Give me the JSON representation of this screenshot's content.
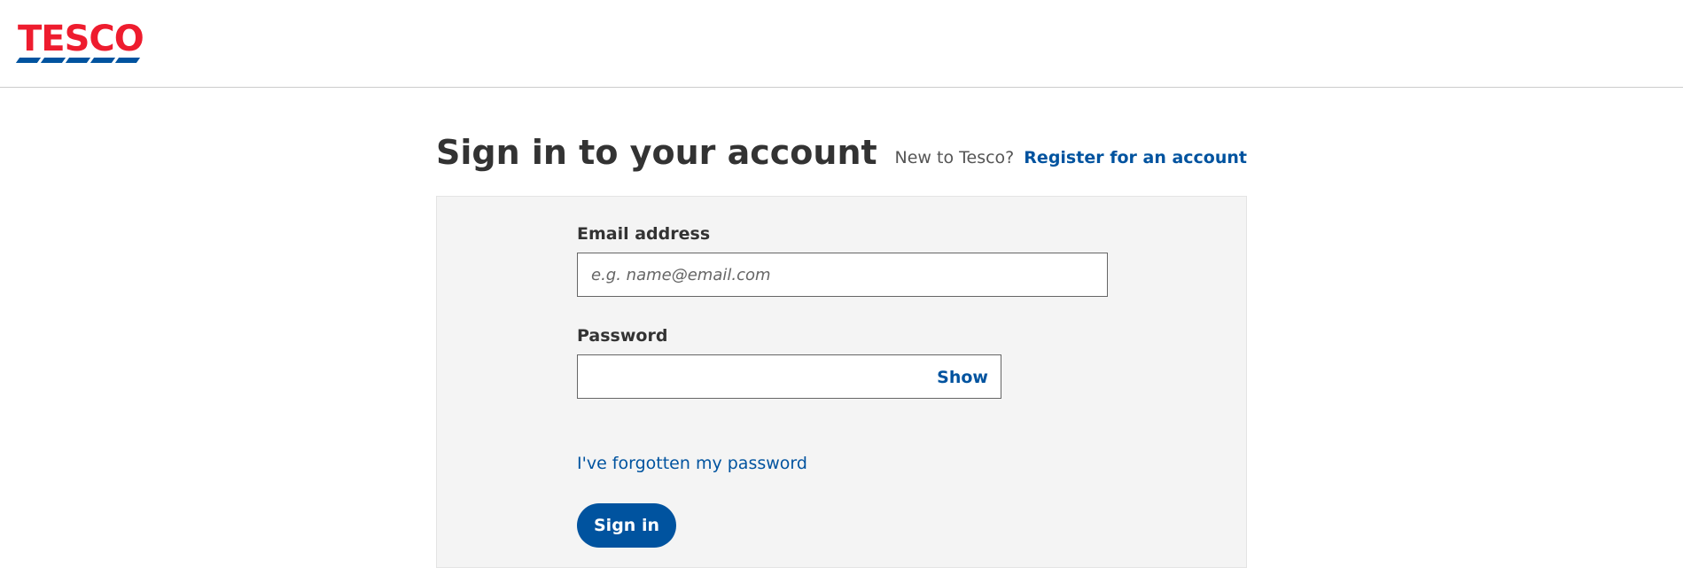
{
  "header": {
    "logo_text": "TESCO",
    "logo_icon": "tesco-logo-icon"
  },
  "main": {
    "title": "Sign in to your account",
    "register_prompt": "New to Tesco?",
    "register_link": "Register for an account"
  },
  "form": {
    "email_label": "Email address",
    "email_placeholder": "e.g. name@email.com",
    "email_value": "",
    "password_label": "Password",
    "password_value": "",
    "show_label": "Show",
    "forgot_label": "I've forgotten my password",
    "signin_label": "Sign in"
  },
  "colors": {
    "brand_red": "#ee1c2e",
    "brand_blue": "#00539f",
    "panel_bg": "#f4f4f4",
    "text": "#333333"
  }
}
